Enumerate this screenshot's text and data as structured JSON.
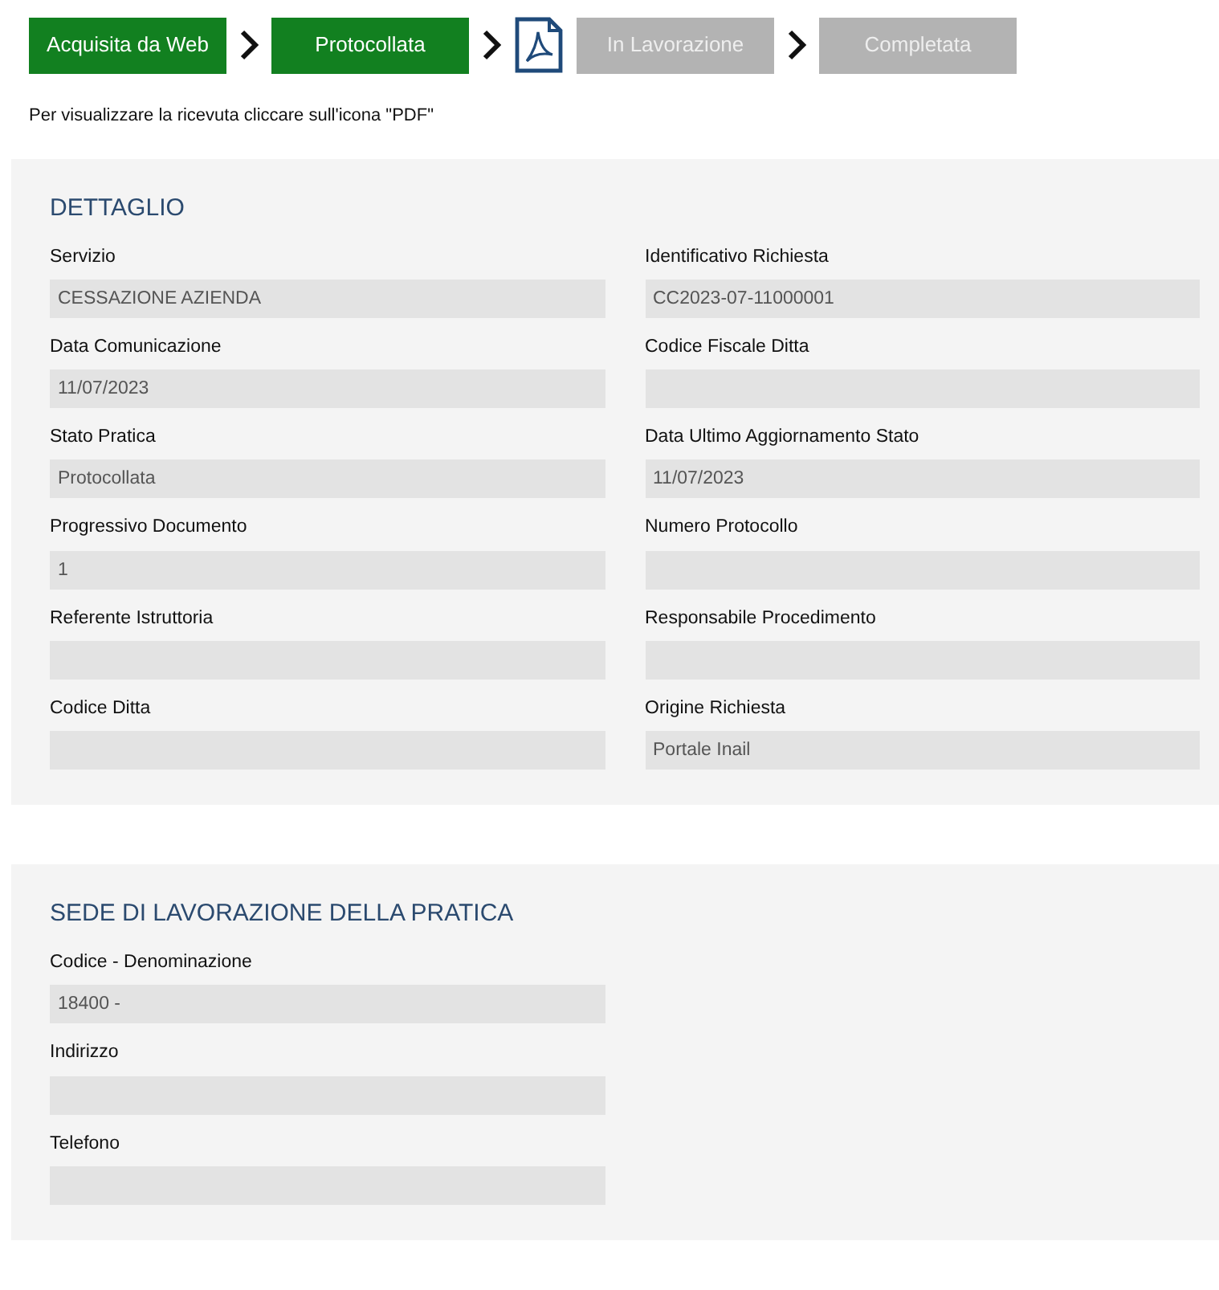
{
  "steps": [
    {
      "label": "Acquisita da Web",
      "completed": true
    },
    {
      "label": "Protocollata",
      "completed": true
    },
    {
      "label": "In Lavorazione",
      "completed": false
    },
    {
      "label": "Completata",
      "completed": false
    }
  ],
  "hint": "Per visualizzare la ricevuta cliccare sull'icona \"PDF\"",
  "sections": [
    {
      "title": "DETTAGLIO",
      "kind": "grid",
      "fields": [
        {
          "label": "Servizio",
          "value": "CESSAZIONE AZIENDA"
        },
        {
          "label": "Identificativo Richiesta",
          "value": "CC2023-07-11000001"
        },
        {
          "label": "Data Comunicazione",
          "value": "11/07/2023"
        },
        {
          "label": "Codice Fiscale Ditta"
        },
        {
          "label": "Stato Pratica",
          "value": "Protocollata"
        },
        {
          "label": "Data Ultimo Aggiornamento Stato",
          "value": "11/07/2023"
        },
        {
          "label": "Progressivo Documento",
          "value": "1"
        },
        {
          "label": "Numero Protocollo"
        },
        {
          "label": "Referente Istruttoria"
        },
        {
          "label": "Responsabile Procedimento"
        },
        {
          "label": "Codice Ditta"
        },
        {
          "label": "Origine Richiesta",
          "value": "Portale Inail"
        }
      ]
    },
    {
      "title": "SEDE DI LAVORAZIONE DELLA PRATICA",
      "kind": "single",
      "fields": [
        {
          "label": "Codice - Denominazione",
          "value": "18400 -"
        },
        {
          "label": "Indirizzo"
        },
        {
          "label": "Telefono"
        }
      ]
    }
  ]
}
